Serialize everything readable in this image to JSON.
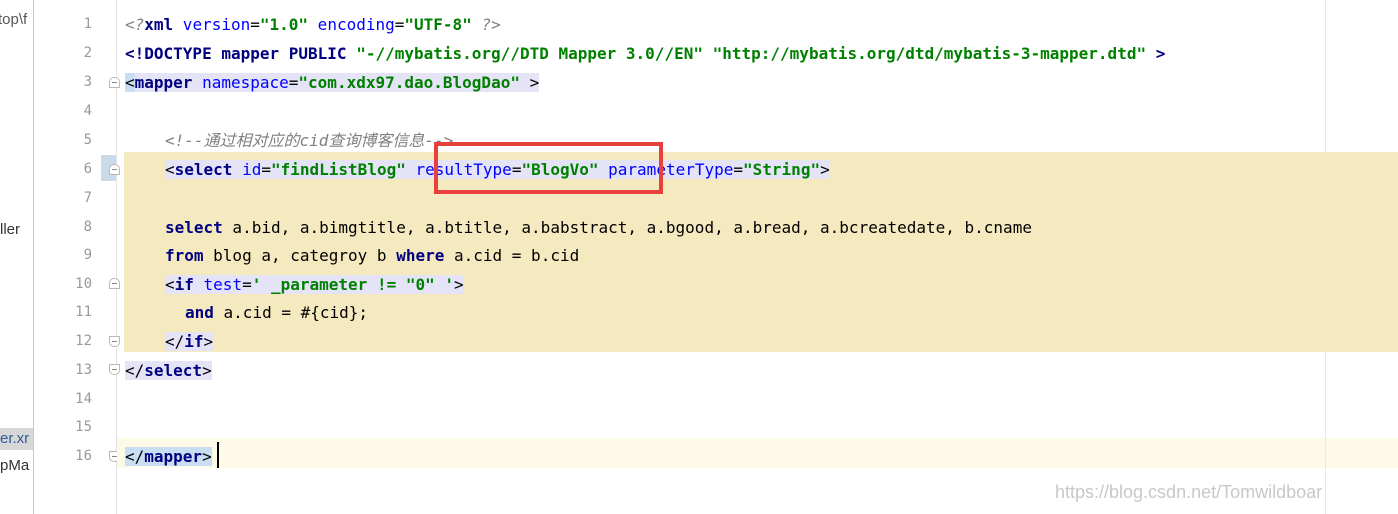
{
  "sidebar": {
    "path_fragment": "top\\f",
    "item_ller": "ller",
    "item_xml": "er.xr",
    "item_pma": "pMa"
  },
  "gutter": {
    "line_numbers": [
      "1",
      "2",
      "3",
      "4",
      "5",
      "6",
      "7",
      "8",
      "9",
      "10",
      "11",
      "12",
      "13",
      "14",
      "15",
      "16"
    ]
  },
  "editor": {
    "line1": {
      "open": "<?",
      "kw": "xml",
      "a1": " version",
      "eq1": "=",
      "v1": "\"1.0\"",
      "a2": " encoding",
      "eq2": "=",
      "v2": "\"UTF-8\"",
      "close": " ?>"
    },
    "line2": {
      "open": "<!DOCTYPE ",
      "kw": "mapper",
      "mid": " PUBLIC ",
      "v1": "\"-//mybatis.org//DTD Mapper 3.0//EN\"",
      "sp": " ",
      "v2": "\"http://mybatis.org/dtd/mybatis-3-mapper.dtd\"",
      "close": " >"
    },
    "line3": {
      "open": "<",
      "kw": "mapper",
      "a1": " namespace",
      "eq1": "=",
      "v1": "\"com.xdx97.dao.BlogDao\"",
      "close": " >"
    },
    "line5": {
      "comment": "<!--通过相对应的cid查询博客信息-->"
    },
    "line6": {
      "open": "<",
      "kw": "select",
      "a1": " id",
      "eq1": "=",
      "v1": "\"findListBlog\"",
      "a2": " resultType",
      "eq2": "=",
      "v2": "\"BlogVo\"",
      "a3": " parameterType",
      "eq3": "=",
      "v3": "\"String\"",
      "close": ">"
    },
    "line8": {
      "kw": "select",
      "rest": " a.bid, a.bimgtitle, a.btitle, a.babstract, a.bgood, a.bread, a.bcreatedate, b.cname"
    },
    "line9": {
      "kw1": "from",
      "mid": " blog a, categroy b ",
      "kw2": "where",
      "rest": " a.cid = b.cid"
    },
    "line10": {
      "open": "<",
      "kw": "if",
      "a1": " test",
      "eq1": "=",
      "v1": "' _parameter != \"0\" '",
      "close": ">"
    },
    "line11": {
      "kw": "and",
      "rest": " a.cid = #{cid};"
    },
    "line12": {
      "open": "</",
      "kw": "if",
      "close": ">"
    },
    "line13": {
      "open": "</",
      "kw": "select",
      "close": ">"
    },
    "line16": {
      "open": "</",
      "kw": "mapper",
      "close": ">"
    }
  },
  "watermark": "https://blog.csdn.net/Tomwildboar",
  "colors": {
    "highlight_block": "#f5eabf",
    "annotation_box": "#e8413b",
    "tag_keyword": "#000080",
    "attribute": "#0000ff",
    "attribute_value": "#008000"
  }
}
